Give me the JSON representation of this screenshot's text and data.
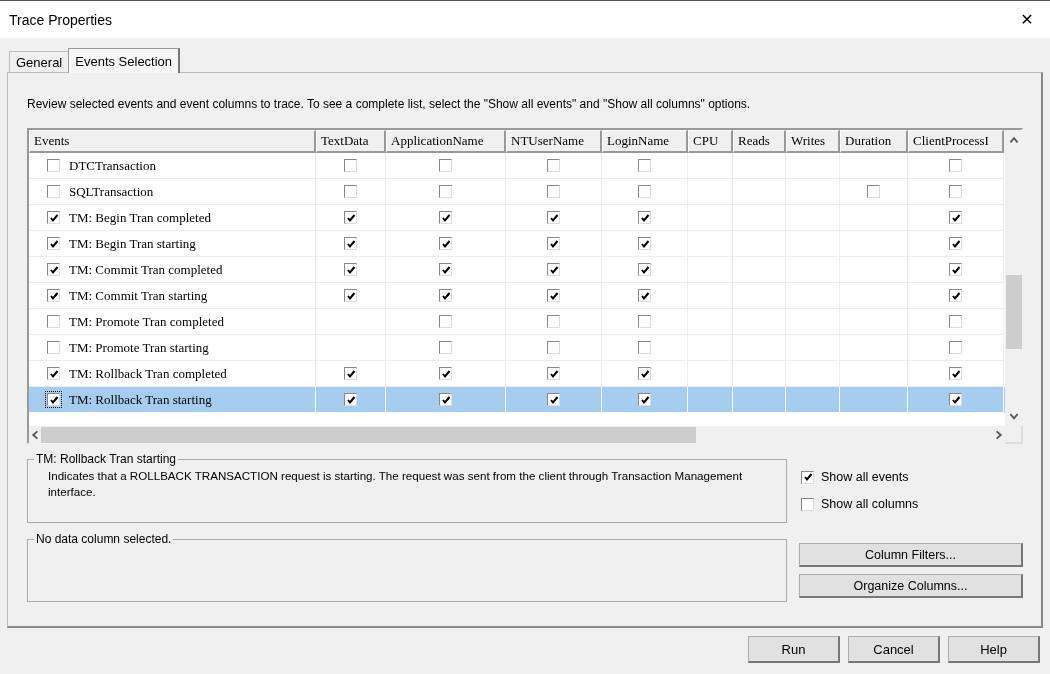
{
  "window": {
    "title": "Trace Properties",
    "close": "✕"
  },
  "tabs": [
    {
      "label": "General",
      "selected": false
    },
    {
      "label": "Events Selection",
      "selected": true
    }
  ],
  "instructions": "Review selected events and event columns to trace. To see a complete list, select the \"Show all events\" and \"Show all columns\" options.",
  "table": {
    "columns": [
      "Events",
      "TextData",
      "ApplicationName",
      "NTUserName",
      "LoginName",
      "CPU",
      "Reads",
      "Writes",
      "Duration",
      "ClientProcessI"
    ],
    "rows": [
      {
        "event": "DTCTransaction",
        "checked": false,
        "selected": false,
        "cells": [
          false,
          false,
          false,
          false,
          null,
          null,
          null,
          null,
          false
        ]
      },
      {
        "event": "SQLTransaction",
        "checked": false,
        "selected": false,
        "cells": [
          false,
          false,
          false,
          false,
          null,
          null,
          null,
          false,
          false
        ]
      },
      {
        "event": "TM: Begin Tran completed",
        "checked": true,
        "selected": false,
        "cells": [
          true,
          true,
          true,
          true,
          null,
          null,
          null,
          null,
          true
        ]
      },
      {
        "event": "TM: Begin Tran starting",
        "checked": true,
        "selected": false,
        "cells": [
          true,
          true,
          true,
          true,
          null,
          null,
          null,
          null,
          true
        ]
      },
      {
        "event": "TM: Commit Tran completed",
        "checked": true,
        "selected": false,
        "cells": [
          true,
          true,
          true,
          true,
          null,
          null,
          null,
          null,
          true
        ]
      },
      {
        "event": "TM: Commit Tran starting",
        "checked": true,
        "selected": false,
        "cells": [
          true,
          true,
          true,
          true,
          null,
          null,
          null,
          null,
          true
        ]
      },
      {
        "event": "TM: Promote Tran completed",
        "checked": false,
        "selected": false,
        "cells": [
          null,
          false,
          false,
          false,
          null,
          null,
          null,
          null,
          false
        ]
      },
      {
        "event": "TM: Promote Tran starting",
        "checked": false,
        "selected": false,
        "cells": [
          null,
          false,
          false,
          false,
          null,
          null,
          null,
          null,
          false
        ]
      },
      {
        "event": "TM: Rollback Tran completed",
        "checked": true,
        "selected": false,
        "cells": [
          true,
          true,
          true,
          true,
          null,
          null,
          null,
          null,
          true
        ]
      },
      {
        "event": "TM: Rollback Tran starting",
        "checked": true,
        "selected": true,
        "cells": [
          true,
          true,
          true,
          true,
          null,
          null,
          null,
          null,
          true
        ]
      }
    ]
  },
  "event_description": {
    "title": "TM: Rollback Tran starting",
    "text": "Indicates that a ROLLBACK TRANSACTION request is starting. The request was sent from the client through Transaction Management interface."
  },
  "options": [
    {
      "label": "Show all events",
      "checked": true
    },
    {
      "label": "Show all columns",
      "checked": false
    }
  ],
  "column_description": {
    "title": "No data column selected."
  },
  "side_buttons": [
    "Column Filters...",
    "Organize Columns..."
  ],
  "buttons": [
    "Run",
    "Cancel",
    "Help"
  ]
}
